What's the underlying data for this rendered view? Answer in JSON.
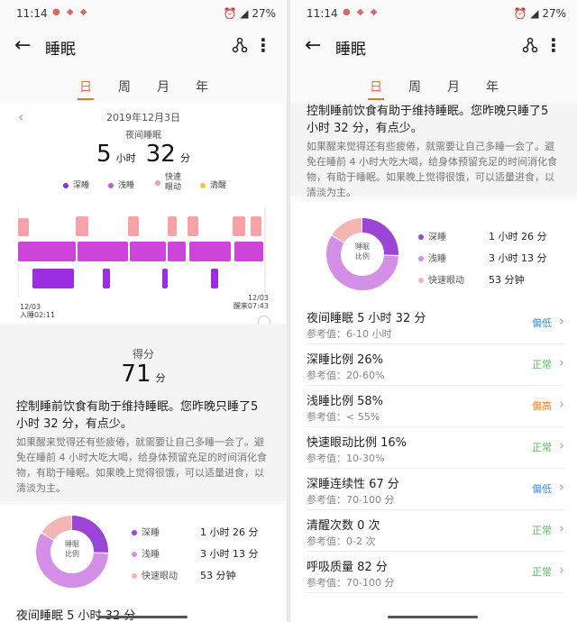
{
  "status_bar": {
    "time": "11:14",
    "battery": "27%"
  },
  "app": {
    "title": "睡眠"
  },
  "tabs": [
    "日",
    "周",
    "月",
    "年"
  ],
  "summary": {
    "date": "2019年12月3日",
    "label": "夜间睡眠",
    "hours": "5",
    "hours_unit": "小时",
    "minutes": "32",
    "minutes_unit": "分"
  },
  "stage_legend": [
    {
      "label": "深睡",
      "color": "#8a2be2"
    },
    {
      "label": "浅睡",
      "color": "#c45ad9"
    },
    {
      "label": "快速眼动",
      "color": "#f2a09e"
    },
    {
      "label": "清醒",
      "color": "#f5c542"
    }
  ],
  "timeline": {
    "start_date": "12/03",
    "start_label": "入睡02:11",
    "end_date": "12/03",
    "end_label": "醒来07:43"
  },
  "score": {
    "label": "得分",
    "value": "71",
    "unit": "分"
  },
  "advice": {
    "title": "控制睡前饮食有助于维持睡眠。您昨晚只睡了5 小时 32 分，有点少。",
    "body": "如果醒来觉得还有些疲倦，就需要让自己多睡一会了。避免在睡前 4 小时大吃大喝，给身体预留充足的时间消化食物，有助于睡眠。如果晚上觉得很饿，可以适量进食，以清淡为主。"
  },
  "donut": {
    "center_line1": "睡眠",
    "center_line2": "比例",
    "slices": [
      {
        "label": "深睡",
        "value": "1 小时 26 分",
        "minutes": 86,
        "color": "#9b45d6"
      },
      {
        "label": "浅睡",
        "value": "3 小时 13 分",
        "minutes": 193,
        "color": "#d48fe6"
      },
      {
        "label": "快速眼动",
        "value": "53 分钟",
        "minutes": 53,
        "color": "#f5b5b3"
      }
    ]
  },
  "metrics": [
    {
      "name": "夜间睡眠  5 小时 32 分",
      "ref": "参考值：6-10 小时",
      "status": "偏低",
      "color": "#3f8fd8"
    },
    {
      "name": "深睡比例  26%",
      "ref": "参考值：20-60%",
      "status": "正常",
      "color": "#5cb85c"
    },
    {
      "name": "浅睡比例  58%",
      "ref": "参考值：< 55%",
      "status": "偏高",
      "color": "#e8822c"
    },
    {
      "name": "快速眼动比例  16%",
      "ref": "参考值：10-30%",
      "status": "正常",
      "color": "#5cb85c"
    },
    {
      "name": "深睡连续性  67 分",
      "ref": "参考值：70-100 分",
      "status": "偏低",
      "color": "#3f8fd8"
    },
    {
      "name": "清醒次数  0 次",
      "ref": "参考值：0-2 次",
      "status": "正常",
      "color": "#5cb85c"
    },
    {
      "name": "呼吸质量  82 分",
      "ref": "参考值：70-100 分",
      "status": "正常",
      "color": "#5cb85c"
    }
  ],
  "left_partial_row": "夜间睡眠  5 小时 32 分"
}
